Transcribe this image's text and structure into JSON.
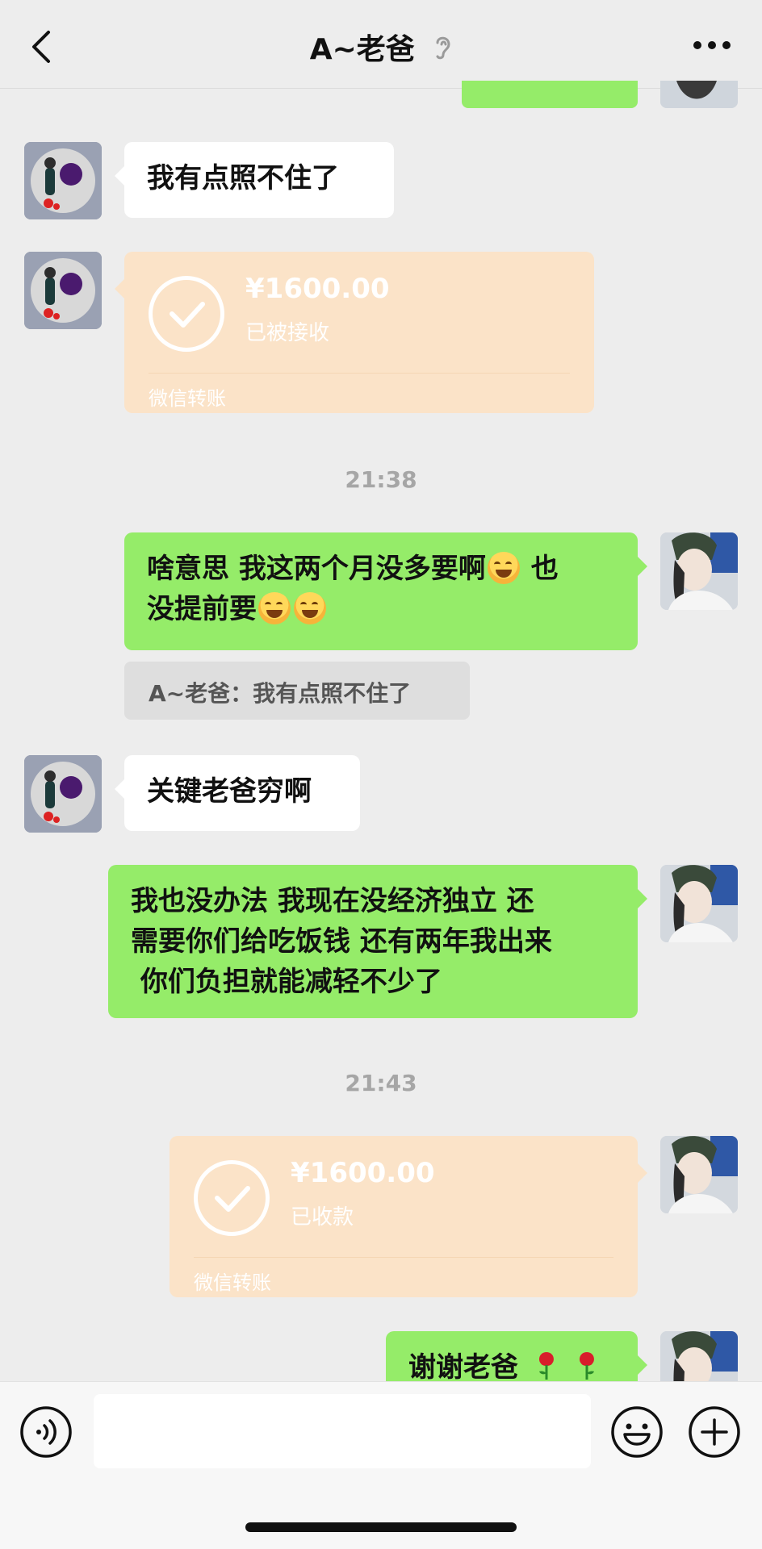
{
  "header": {
    "title": "A~老爸",
    "back_icon": "chevron-left-icon",
    "more_icon": "more-dots-icon",
    "ear_icon": "ear-icon"
  },
  "colors": {
    "background": "#ededed",
    "green_bubble": "#95ec69",
    "white_bubble": "#ffffff",
    "transfer_bubble": "#fbe3c8",
    "timestamp": "#a6a6a6"
  },
  "messages": [
    {
      "from": "dad",
      "type": "text",
      "text": "我有点照不住了"
    },
    {
      "from": "dad",
      "type": "transfer",
      "amount": "¥1600.00",
      "status": "已被接收",
      "footer": "微信转账"
    },
    {
      "type": "time",
      "text": "21:38"
    },
    {
      "from": "me",
      "type": "text",
      "line1": "啥意思 我这两个月没多要啊",
      "line1b": "也",
      "line2": "没提前要"
    },
    {
      "type": "quote",
      "text": "A~老爸：我有点照不住了"
    },
    {
      "from": "dad",
      "type": "text",
      "text": "关键老爸穷啊"
    },
    {
      "from": "me",
      "type": "text",
      "line1": "我也没办法 我现在没经济独立  还",
      "line2": "需要你们给吃饭钱 还有两年我出来",
      "line3": " 你们负担就能减轻不少了"
    },
    {
      "type": "time",
      "text": "21:43"
    },
    {
      "from": "me",
      "type": "transfer",
      "amount": "¥1600.00",
      "status": "已收款",
      "footer": "微信转账"
    },
    {
      "from": "me",
      "type": "text",
      "text": "谢谢老爸",
      "emoji": "rose-icon"
    }
  ],
  "input": {
    "voice_icon": "voice-icon",
    "emoji_icon": "emoji-icon",
    "plus_icon": "plus-icon",
    "value": ""
  }
}
